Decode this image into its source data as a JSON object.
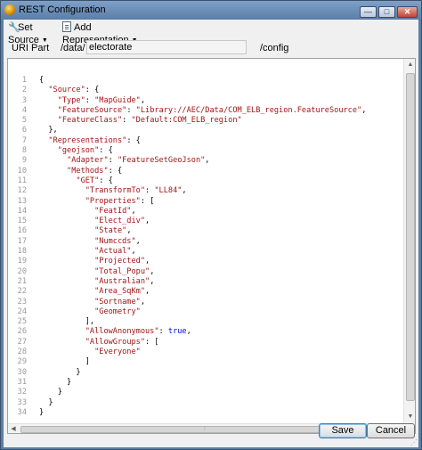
{
  "window": {
    "title": "REST Configuration",
    "caption_buttons": [
      "—",
      "□",
      "✕"
    ]
  },
  "toolbar": {
    "set_source": "Set Source",
    "add_representation": "Add Representation"
  },
  "uri": {
    "label": "URI Part",
    "prefix": "/data/",
    "value": "electorate",
    "suffix": "/config"
  },
  "editor": {
    "lines": [
      {
        "n": "1",
        "text": "{"
      },
      {
        "n": "2",
        "text": "  \"Source\": {"
      },
      {
        "n": "3",
        "text": "    \"Type\": \"MapGuide\","
      },
      {
        "n": "4",
        "text": "    \"FeatureSource\": \"Library://AEC/Data/COM_ELB_region.FeatureSource\","
      },
      {
        "n": "5",
        "text": "    \"FeatureClass\": \"Default:COM_ELB_region\""
      },
      {
        "n": "6",
        "text": "  },"
      },
      {
        "n": "7",
        "text": "  \"Representations\": {"
      },
      {
        "n": "8",
        "text": "    \"geojson\": {"
      },
      {
        "n": "9",
        "text": "      \"Adapter\": \"FeatureSetGeoJson\","
      },
      {
        "n": "10",
        "text": "      \"Methods\": {"
      },
      {
        "n": "11",
        "text": "        \"GET\": {"
      },
      {
        "n": "12",
        "text": "          \"TransformTo\": \"LL84\","
      },
      {
        "n": "13",
        "text": "          \"Properties\": ["
      },
      {
        "n": "14",
        "text": "            \"FeatId\","
      },
      {
        "n": "15",
        "text": "            \"Elect_div\","
      },
      {
        "n": "16",
        "text": "            \"State\","
      },
      {
        "n": "17",
        "text": "            \"Numccds\","
      },
      {
        "n": "18",
        "text": "            \"Actual\","
      },
      {
        "n": "19",
        "text": "            \"Projected\","
      },
      {
        "n": "20",
        "text": "            \"Total_Popu\","
      },
      {
        "n": "21",
        "text": "            \"Australian\","
      },
      {
        "n": "22",
        "text": "            \"Area_SqKm\","
      },
      {
        "n": "23",
        "text": "            \"Sortname\","
      },
      {
        "n": "24",
        "text": "            \"Geometry\""
      },
      {
        "n": "25",
        "text": "          ],"
      },
      {
        "n": "26",
        "text": "          \"AllowAnonymous\": true,"
      },
      {
        "n": "27",
        "text": "          \"AllowGroups\": ["
      },
      {
        "n": "28",
        "text": "            \"Everyone\""
      },
      {
        "n": "29",
        "text": "          ]"
      },
      {
        "n": "30",
        "text": "        }"
      },
      {
        "n": "31",
        "text": "      }"
      },
      {
        "n": "32",
        "text": "    }"
      },
      {
        "n": "33",
        "text": "  }"
      },
      {
        "n": "34",
        "text": "}"
      }
    ]
  },
  "buttons": {
    "save": "Save",
    "cancel": "Cancel"
  }
}
